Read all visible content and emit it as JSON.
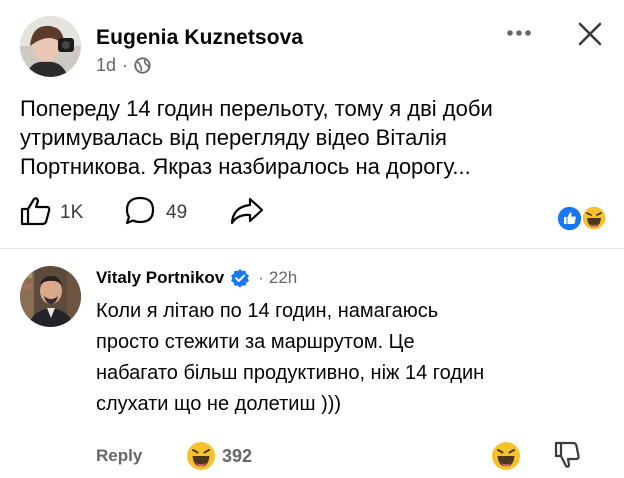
{
  "post": {
    "author": "Eugenia Kuznetsova",
    "time": "1d",
    "separator": "·",
    "audience_icon": "globe-icon",
    "text_lines": [
      "Попереду 14 годин перельоту, тому я дві доби",
      "утримувалась від перегляду відео Віталія",
      "Портникова. Якраз назбиралось на дорогу..."
    ],
    "likes": "1K",
    "comments": "49",
    "reaction_icons": [
      "like-reaction-icon",
      "haha-reaction-icon"
    ],
    "colors": {
      "like_blue": "#1877f2",
      "emoji_yellow": "#f7c12b",
      "muted": "#65676b"
    }
  },
  "comment": {
    "author": "Vitaly Portnikov",
    "verified_icon": "verified-badge-icon",
    "separator": "·",
    "time": "22h",
    "text_lines": [
      "Коли я літаю по 14 годин, намагаюсь",
      "просто стежити за маршрутом. Це",
      "набагато більш продуктивно, ніж 14 годин",
      "слухати що не долетиш )))"
    ],
    "reply_label": "Reply",
    "reaction_count": "392",
    "reaction_icon": "haha-reaction-icon"
  }
}
